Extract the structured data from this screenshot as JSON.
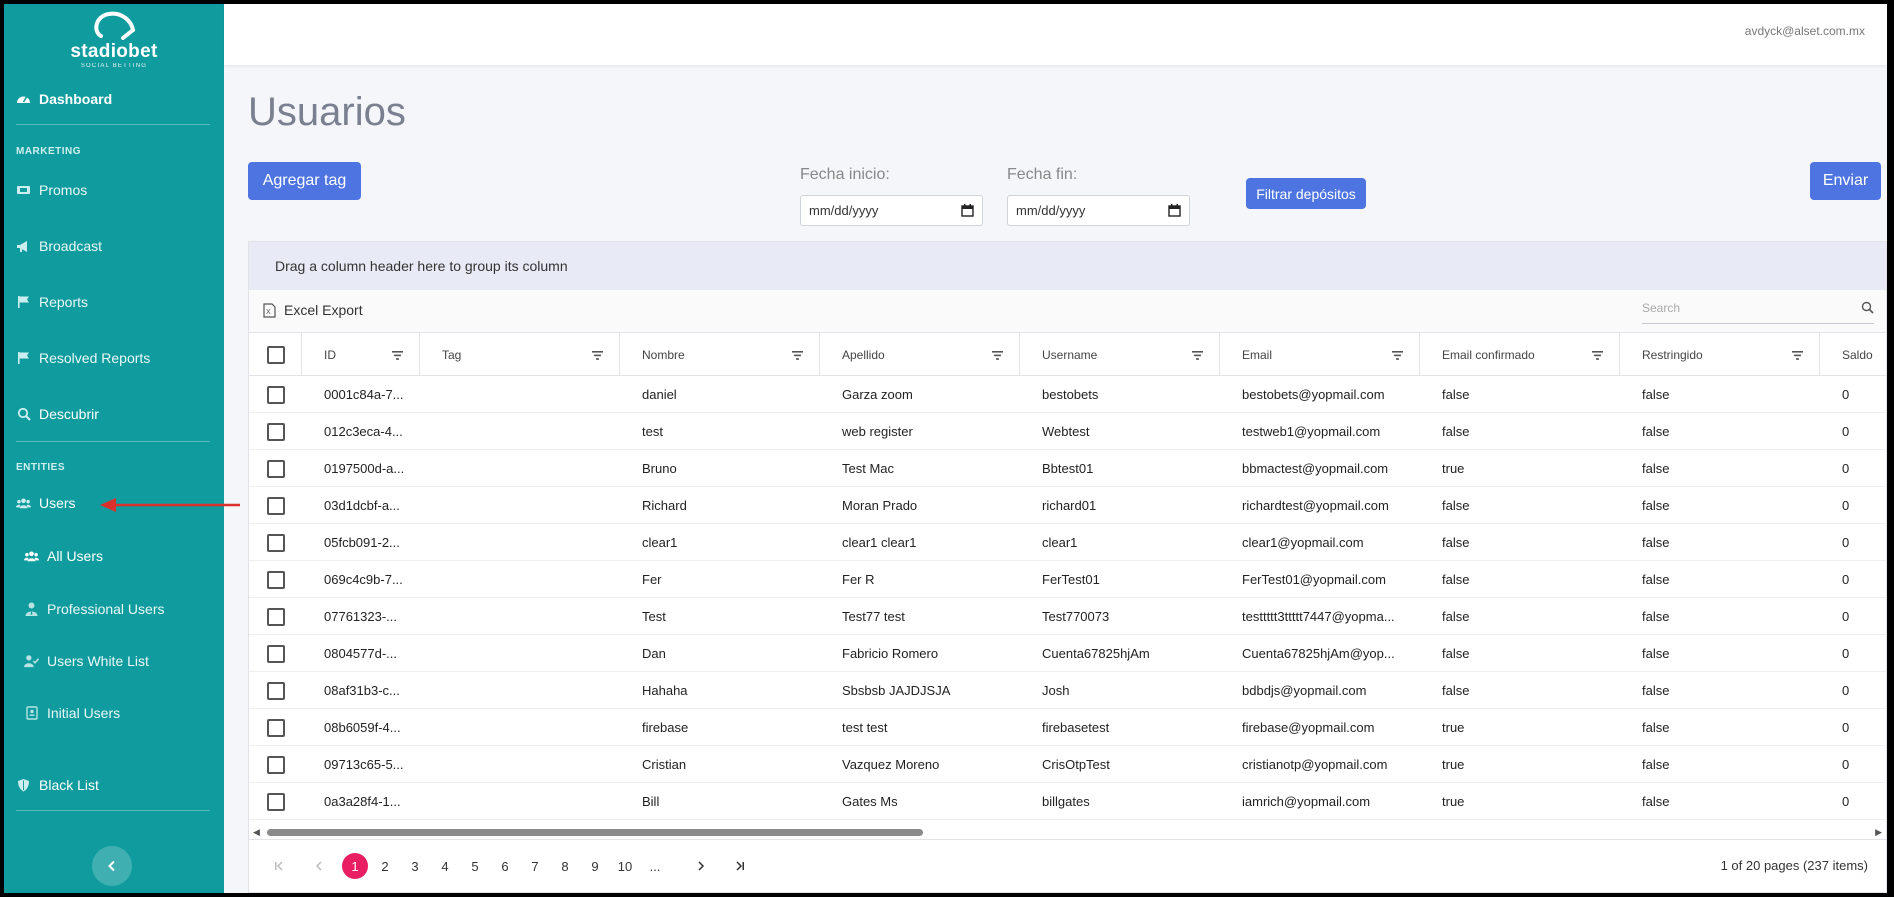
{
  "brand": {
    "name": "stadiobet",
    "tagline": "SOCIAL BETTING"
  },
  "sidebar": {
    "dashboard": "Dashboard",
    "marketing_label": "MARKETING",
    "promos": "Promos",
    "broadcast": "Broadcast",
    "reports": "Reports",
    "resolved_reports": "Resolved Reports",
    "descubrir": "Descubrir",
    "entities_label": "ENTITIES",
    "users": "Users",
    "all_users": "All Users",
    "professional_users": "Professional Users",
    "users_white_list": "Users White List",
    "initial_users": "Initial Users",
    "black_list": "Black List",
    "collapse_icon": "chevron-left-icon"
  },
  "header": {
    "user_email": "avdyck@alset.com.mx"
  },
  "page": {
    "title": "Usuarios",
    "add_tag_label": "Agregar tag",
    "fecha_inicio_label": "Fecha inicio:",
    "fecha_inicio_placeholder": "mm/dd/yyyy",
    "fecha_fin_label": "Fecha fin:",
    "fecha_fin_placeholder": "mm/dd/yyyy",
    "filter_label": "Filtrar depósitos",
    "send_label": "Enviar"
  },
  "grid": {
    "group_hint": "Drag a column header here to group its column",
    "excel_export": "Excel Export",
    "search_placeholder": "Search",
    "columns": [
      "ID",
      "Tag",
      "Nombre",
      "Apellido",
      "Username",
      "Email",
      "Email confirmado",
      "Restringido",
      "Saldo"
    ],
    "rows": [
      [
        "0001c84a-7...",
        "",
        "daniel",
        "Garza zoom",
        "bestobets",
        "bestobets@yopmail.com",
        "false",
        "false",
        "0"
      ],
      [
        "012c3eca-4...",
        "",
        "test",
        "web register",
        "Webtest",
        "testweb1@yopmail.com",
        "false",
        "false",
        "0"
      ],
      [
        "0197500d-a...",
        "",
        "Bruno",
        "Test Mac",
        "Bbtest01",
        "bbmactest@yopmail.com",
        "true",
        "false",
        "0"
      ],
      [
        "03d1dcbf-a...",
        "",
        "Richard",
        "Moran Prado",
        "richard01",
        "richardtest@yopmail.com",
        "false",
        "false",
        "0"
      ],
      [
        "05fcb091-2...",
        "",
        "clear1",
        "clear1 clear1",
        "clear1",
        "clear1@yopmail.com",
        "false",
        "false",
        "0"
      ],
      [
        "069c4c9b-7...",
        "",
        "Fer",
        "Fer R",
        "FerTest01",
        "FerTest01@yopmail.com",
        "false",
        "false",
        "0"
      ],
      [
        "07761323-...",
        "",
        "Test",
        "Test77 test",
        "Test770073",
        "testtttt3ttttt7447@yopma...",
        "false",
        "false",
        "0"
      ],
      [
        "0804577d-...",
        "",
        "Dan",
        "Fabricio Romero",
        "Cuenta67825hjAm",
        "Cuenta67825hjAm@yop...",
        "false",
        "false",
        "0"
      ],
      [
        "08af31b3-c...",
        "",
        "Hahaha",
        "Sbsbsb JAJDJSJA",
        "Josh",
        "bdbdjs@yopmail.com",
        "false",
        "false",
        "0"
      ],
      [
        "08b6059f-4...",
        "",
        "firebase",
        "test test",
        "firebasetest",
        "firebase@yopmail.com",
        "true",
        "false",
        "0"
      ],
      [
        "09713c65-5...",
        "",
        "Cristian",
        "Vazquez Moreno",
        "CrisOtpTest",
        "cristianotp@yopmail.com",
        "true",
        "false",
        "0"
      ],
      [
        "0a3a28f4-1...",
        "",
        "Bill",
        "Gates Ms",
        "billgates",
        "iamrich@yopmail.com",
        "true",
        "false",
        "0"
      ]
    ],
    "pages": [
      "1",
      "2",
      "3",
      "4",
      "5",
      "6",
      "7",
      "8",
      "9",
      "10",
      "..."
    ],
    "current_page": "1",
    "pager_info": "1 of 20 pages (237 items)"
  }
}
